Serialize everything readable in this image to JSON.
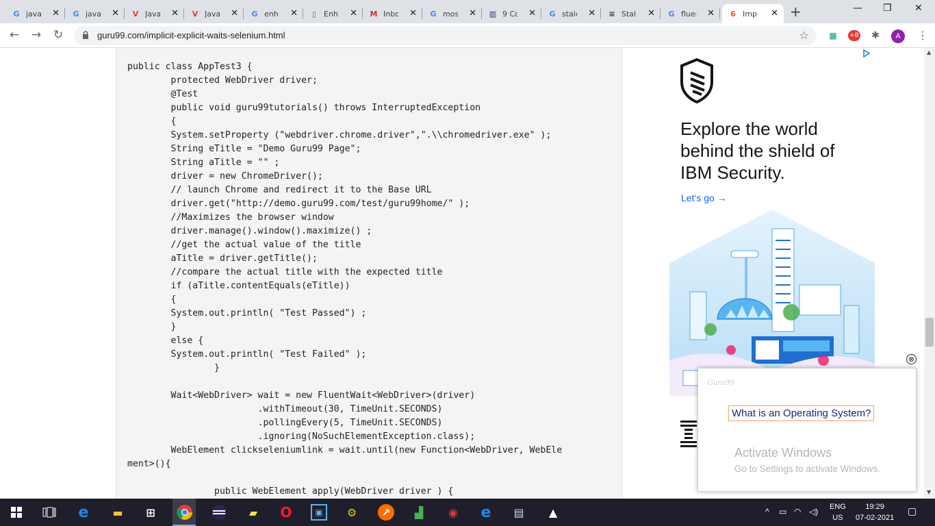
{
  "browser": {
    "tabs": [
      {
        "title": "java",
        "icon": "google-icon",
        "favicon_text": "G",
        "favicon_color": "#4285f4"
      },
      {
        "title": "java",
        "icon": "google-icon",
        "favicon_text": "G",
        "favicon_color": "#4285f4"
      },
      {
        "title": "Java",
        "icon": "v-icon",
        "favicon_text": "V",
        "favicon_color": "#e53935"
      },
      {
        "title": "Java",
        "icon": "v-icon",
        "favicon_text": "V",
        "favicon_color": "#e53935"
      },
      {
        "title": "enh",
        "icon": "google-icon",
        "favicon_text": "G",
        "favicon_color": "#4285f4"
      },
      {
        "title": "Enh",
        "icon": "document-icon",
        "favicon_text": "▯",
        "favicon_color": "#0f9d58"
      },
      {
        "title": "Inbo",
        "icon": "gmail-icon",
        "favicon_text": "M",
        "favicon_color": "#d93025"
      },
      {
        "title": "mos",
        "icon": "google-icon",
        "favicon_text": "G",
        "favicon_color": "#4285f4"
      },
      {
        "title": "9 Cc",
        "icon": "chart-icon",
        "favicon_text": "▥",
        "favicon_color": "#1a3d7c"
      },
      {
        "title": "stale",
        "icon": "google-icon",
        "favicon_text": "G",
        "favicon_color": "#4285f4"
      },
      {
        "title": "Stale",
        "icon": "site-icon",
        "favicon_text": "≡",
        "favicon_color": "#333333"
      },
      {
        "title": "fluer",
        "icon": "google-icon",
        "favicon_text": "G",
        "favicon_color": "#4285f4"
      },
      {
        "title": "Impl",
        "icon": "guru99-icon",
        "favicon_text": "6",
        "favicon_color": "#f4511e",
        "active": true
      }
    ],
    "new_tab": "+",
    "window_controls": {
      "minimize": "—",
      "maximize": "❐",
      "close": "✕"
    },
    "url": "guru99.com/implicit-explicit-waits-selenium.html",
    "avatar_letter": "A",
    "extension_badge": "+B"
  },
  "code_lines": [
    "public class AppTest3 {",
    "        protected WebDriver driver;",
    "        @Test",
    "        public void guru99tutorials() throws InterruptedException",
    "        {",
    "        System.setProperty (\"webdriver.chrome.driver\",\".\\\\chromedriver.exe\" );",
    "        String eTitle = \"Demo Guru99 Page\";",
    "        String aTitle = \"\" ;",
    "        driver = new ChromeDriver();",
    "        // launch Chrome and redirect it to the Base URL",
    "        driver.get(\"http://demo.guru99.com/test/guru99home/\" );",
    "        //Maximizes the browser window",
    "        driver.manage().window().maximize() ;",
    "        //get the actual value of the title",
    "        aTitle = driver.getTitle();",
    "        //compare the actual title with the expected title",
    "        if (aTitle.contentEquals(eTitle))",
    "        {",
    "        System.out.println( \"Test Passed\") ;",
    "        }",
    "        else {",
    "        System.out.println( \"Test Failed\" );",
    "                }",
    "",
    "        Wait<WebDriver> wait = new FluentWait<WebDriver>(driver)",
    "                        .withTimeout(30, TimeUnit.SECONDS)",
    "                        .pollingEvery(5, TimeUnit.SECONDS)",
    "                        .ignoring(NoSuchElementException.class);",
    "        WebElement clickseleniumlink = wait.until(new Function<WebDriver, WebEle",
    "ment>(){",
    "",
    "                public WebElement apply(WebDriver driver ) {"
  ],
  "ad": {
    "headline": "Explore the world behind the shield of IBM Security.",
    "cta": "Let’s go →",
    "adchoices_icon": "ad-choices-icon",
    "brand_color": "#0f62fe"
  },
  "popup": {
    "brand": "Guru99",
    "link": "What is an Operating System?",
    "close": "⊗"
  },
  "watermark": {
    "line1": "Activate Windows",
    "line2": "Go to Settings to activate Windows."
  },
  "taskbar": {
    "language_top": "ENG",
    "language_bottom": "US",
    "time": "19:29",
    "date": "07-02-2021"
  }
}
